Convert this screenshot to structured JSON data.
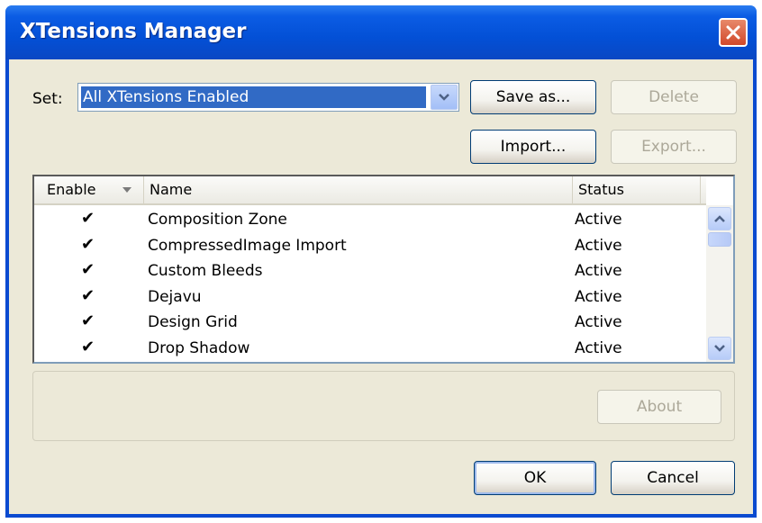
{
  "window": {
    "title": "XTensions Manager",
    "close_icon": "close-x-icon",
    "title_color": "#0a4ad0",
    "close_color": "#d1482a"
  },
  "set": {
    "label": "Set:",
    "selected_value": "All XTensions Enabled",
    "highlight_color": "#316ac5"
  },
  "buttons": {
    "save_as": "Save as...",
    "delete": "Delete",
    "import": "Import...",
    "export": "Export...",
    "about": "About",
    "ok": "OK",
    "cancel": "Cancel"
  },
  "list": {
    "columns": [
      "Enable",
      "Name",
      "Status"
    ],
    "rows": [
      {
        "enabled": "✔",
        "name": "Composition Zone",
        "status": "Active"
      },
      {
        "enabled": "✔",
        "name": "CompressedImage Import",
        "status": "Active"
      },
      {
        "enabled": "✔",
        "name": "Custom Bleeds",
        "status": "Active"
      },
      {
        "enabled": "✔",
        "name": "Dejavu",
        "status": "Active"
      },
      {
        "enabled": "✔",
        "name": "Design Grid",
        "status": "Active"
      },
      {
        "enabled": "✔",
        "name": "Drop Shadow",
        "status": "Active"
      }
    ]
  }
}
